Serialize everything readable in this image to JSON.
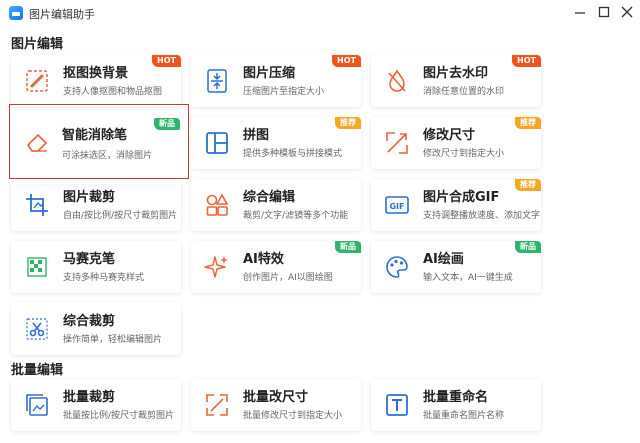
{
  "app": {
    "title": "图片编辑助手"
  },
  "sections": {
    "edit": "图片编辑",
    "batch": "批量编辑"
  },
  "cards": {
    "cutout": {
      "title": "抠图换背景",
      "desc": "支持人像抠图和物品抠图",
      "badge": "HOT"
    },
    "compress": {
      "title": "图片压缩",
      "desc": "压缩图片至指定大小",
      "badge": "HOT"
    },
    "watermark": {
      "title": "图片去水印",
      "desc": "消除任意位置的水印",
      "badge": "HOT"
    },
    "eraser": {
      "title": "智能消除笔",
      "desc": "可涂抹选区，消除图片",
      "badge": "新品"
    },
    "collage": {
      "title": "拼图",
      "desc": "提供多种模板与拼接模式",
      "badge": "推荐"
    },
    "resize": {
      "title": "修改尺寸",
      "desc": "修改尺寸到指定大小",
      "badge": "推荐"
    },
    "crop": {
      "title": "图片裁剪",
      "desc": "自由/按比例/按尺寸裁剪图片"
    },
    "combo_edit": {
      "title": "综合编辑",
      "desc": "裁剪/文字/滤镜等多个功能"
    },
    "gif": {
      "title": "图片合成GIF",
      "desc": "支持调整播放速度、添加文字",
      "badge": "推荐"
    },
    "mosaic": {
      "title": "马赛克笔",
      "desc": "支持多种马赛克样式"
    },
    "ai_effect": {
      "title": "AI特效",
      "desc": "创作图片，AI以图绘图",
      "badge": "新品"
    },
    "ai_paint": {
      "title": "AI绘画",
      "desc": "输入文本，AI一键生成",
      "badge": "新品"
    },
    "combo_crop": {
      "title": "综合裁剪",
      "desc": "操作简单，轻松编辑图片"
    },
    "batch_crop": {
      "title": "批量裁剪",
      "desc": "批量按比例/按尺寸裁剪图片"
    },
    "batch_resize": {
      "title": "批量改尺寸",
      "desc": "批量修改尺寸到指定大小"
    },
    "batch_rename": {
      "title": "批量重命名",
      "desc": "批量重命名图片名称"
    }
  },
  "colors": {
    "accent": "#f0541e",
    "hot": "#f0541e",
    "new": "#2fb56a",
    "recommend": "#f5a623",
    "highlight": "#c23a3a",
    "icon_blue": "#2b6fd6",
    "icon_orange": "#e8663a"
  }
}
